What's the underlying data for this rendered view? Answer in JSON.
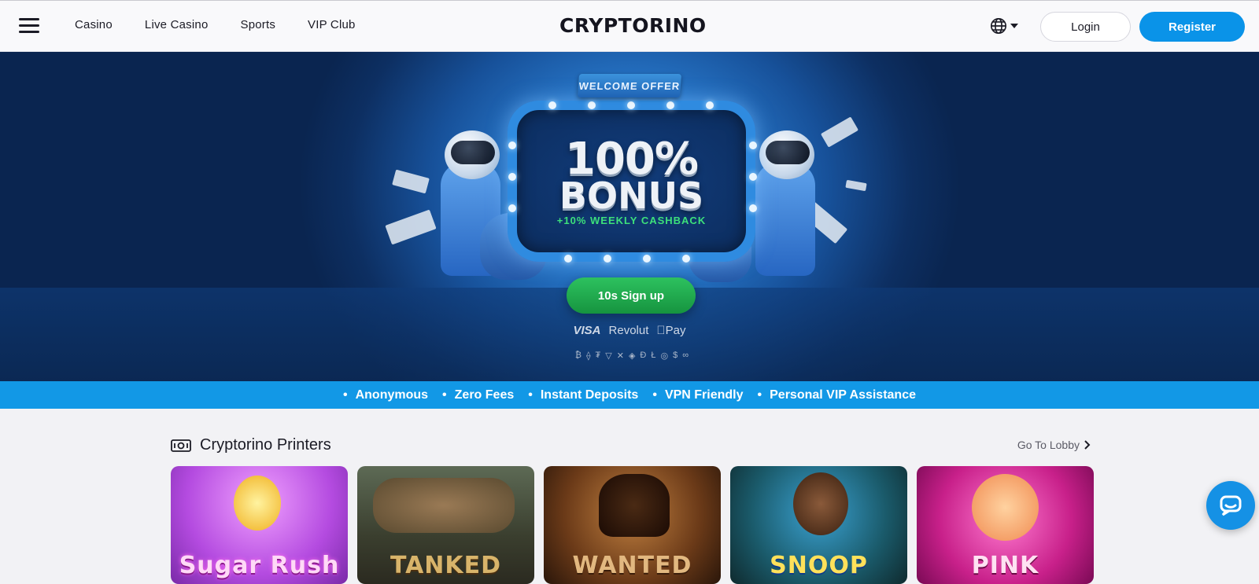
{
  "header": {
    "nav": [
      "Casino",
      "Live Casino",
      "Sports",
      "VIP Club"
    ],
    "logo": "CRYPTORINO",
    "login_label": "Login",
    "register_label": "Register",
    "language_icon": "globe-icon"
  },
  "hero": {
    "ribbon": "WELCOME OFFER",
    "headline_1": "100%",
    "headline_2": "BONUS",
    "cashback": "+10% WEEKLY CASHBACK",
    "cta_label": "10s Sign up",
    "payments": [
      "VISA",
      "Revolut",
      "Pay"
    ],
    "crypto_icons": [
      "₿",
      "⟠",
      "₮",
      "▽",
      "✕",
      "◈",
      "Ð",
      "Ł",
      "◎",
      "$",
      "∞"
    ]
  },
  "benefits": [
    "Anonymous",
    "Zero Fees",
    "Instant Deposits",
    "VPN Friendly",
    "Personal VIP Assistance"
  ],
  "section": {
    "title": "Cryptorino Printers",
    "lobby_label": "Go To Lobby"
  },
  "games": [
    {
      "title": "Sugar Rush"
    },
    {
      "title": "TANKED"
    },
    {
      "title": "WANTED"
    },
    {
      "title": "SNOOP"
    },
    {
      "title": "PINK"
    }
  ],
  "colors": {
    "accent": "#0a93e8",
    "cta": "#22b050",
    "benefits_bar": "#1298e6"
  }
}
